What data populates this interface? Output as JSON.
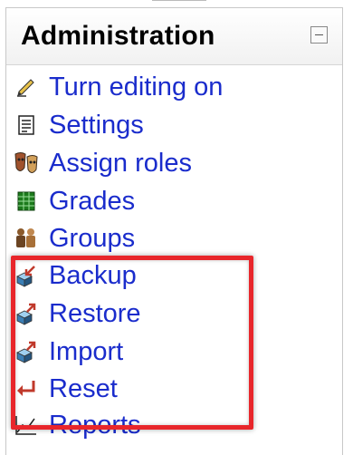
{
  "block": {
    "title": "Administration"
  },
  "menu": {
    "items": [
      {
        "label": "Turn editing on",
        "icon": "pencil-edit-icon"
      },
      {
        "label": "Settings",
        "icon": "settings-document-icon"
      },
      {
        "label": "Assign roles",
        "icon": "roles-masks-icon"
      },
      {
        "label": "Grades",
        "icon": "grades-table-icon"
      },
      {
        "label": "Groups",
        "icon": "groups-people-icon"
      },
      {
        "label": "Backup",
        "icon": "backup-box-icon"
      },
      {
        "label": "Restore",
        "icon": "restore-box-icon"
      },
      {
        "label": "Import",
        "icon": "import-box-icon"
      },
      {
        "label": "Reset",
        "icon": "reset-arrow-icon"
      },
      {
        "label": "Reports",
        "icon": "reports-chart-icon"
      }
    ]
  },
  "colors": {
    "link": "#1a2ccc",
    "highlight_border": "#e8262b"
  }
}
